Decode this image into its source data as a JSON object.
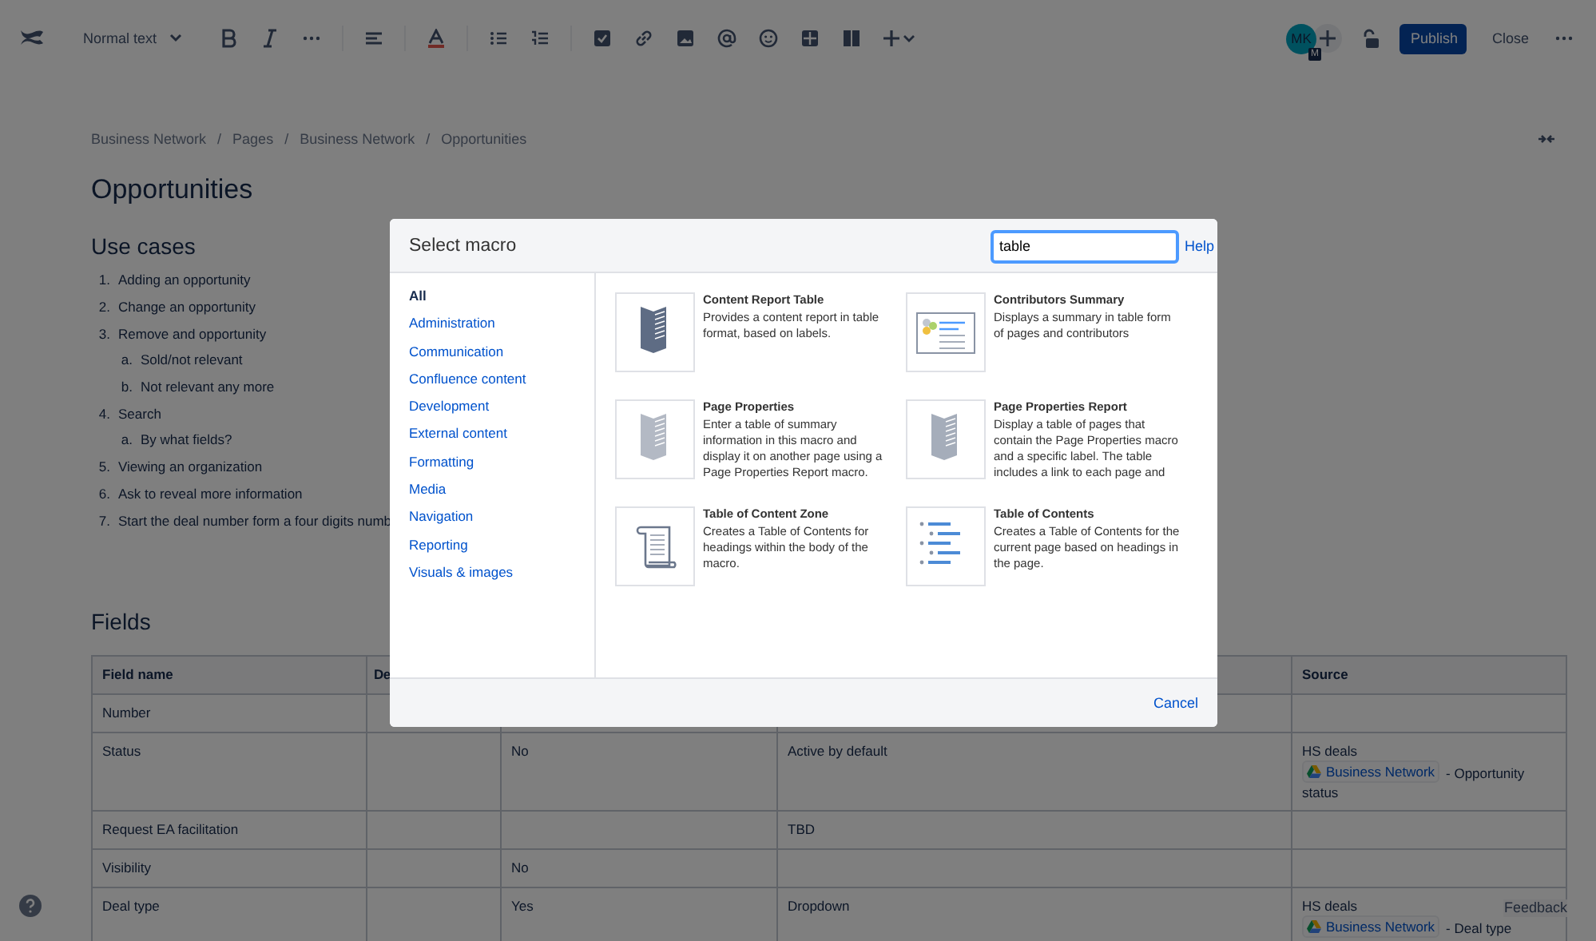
{
  "toolbar": {
    "text_style": "Normal text",
    "avatar": {
      "initials": "MK",
      "badge": "M"
    },
    "publish": "Publish",
    "close": "Close"
  },
  "breadcrumbs": [
    {
      "label": "Business Network"
    },
    {
      "separator": "/",
      "label": "Pages"
    },
    {
      "separator": "/",
      "label": "Business Network"
    },
    {
      "separator": "/",
      "label": "Opportunities"
    }
  ],
  "page_title": "Opportunities",
  "use_cases": {
    "heading": "Use cases",
    "items": [
      {
        "marker": "1.",
        "text": "Adding an opportunity"
      },
      {
        "marker": "2.",
        "text": "Change an opportunity"
      },
      {
        "marker": "3.",
        "text": "Remove and opportunity",
        "children": [
          {
            "marker": "a.",
            "text": "Sold/not relevant"
          },
          {
            "marker": "b.",
            "text": "Not relevant any more"
          }
        ]
      },
      {
        "marker": "4.",
        "text": "Search",
        "children": [
          {
            "marker": "a.",
            "text": "By what fields?"
          }
        ]
      },
      {
        "marker": "5.",
        "text": "Viewing an organization"
      },
      {
        "marker": "6.",
        "text": "Ask to reveal more information"
      },
      {
        "marker": "7.",
        "text": "Start the deal number form a four digits numb"
      }
    ]
  },
  "fields": {
    "heading": "Fields",
    "columns": [
      "Field name",
      "De",
      null,
      null,
      "Source"
    ],
    "rows": [
      [
        "Number",
        null,
        null,
        null,
        null
      ],
      [
        "Status",
        null,
        "No",
        "Active by default",
        {
          "text": "HS deals",
          "link": "Business Network",
          "after": "- Opportunity status"
        }
      ],
      [
        "Request EA facilitation",
        null,
        null,
        "TBD",
        null
      ],
      [
        "Visibility",
        null,
        "No",
        null,
        null
      ],
      [
        "Deal type",
        null,
        "Yes",
        "Dropdown",
        {
          "text": "HS deals",
          "link": "Business Network",
          "after": "- Deal type"
        }
      ]
    ]
  },
  "feedback": "Feedback",
  "dialog": {
    "title": "Select macro",
    "search": {
      "value": "table"
    },
    "help": "Help",
    "categories": [
      {
        "label": "All",
        "selected": true
      },
      {
        "label": "Administration",
        "selected": false
      },
      {
        "label": "Communication",
        "selected": false
      },
      {
        "label": "Confluence content",
        "selected": false
      },
      {
        "label": "Development",
        "selected": false
      },
      {
        "label": "External content",
        "selected": false
      },
      {
        "label": "Formatting",
        "selected": false
      },
      {
        "label": "Media",
        "selected": false
      },
      {
        "label": "Navigation",
        "selected": false
      },
      {
        "label": "Reporting",
        "selected": false
      },
      {
        "label": "Visuals & images",
        "selected": false
      }
    ],
    "macros": [
      {
        "kind": "report",
        "name": "Content Report Table",
        "description": "Provides a content report in table format, based on labels."
      },
      {
        "kind": "summary",
        "name": "Contributors Summary",
        "description": "Displays a summary in table form of pages and contributors"
      },
      {
        "kind": "properties",
        "name": "Page Properties",
        "description": "Enter a table of summary information in this macro and display it on another page using a Page Properties Report macro."
      },
      {
        "kind": "propreport",
        "name": "Page Properties Report",
        "description": "Display a table of pages that contain the Page Properties macro and a specific label. The table includes a link to each page and"
      },
      {
        "kind": "zone",
        "name": "Table of Content Zone",
        "description": "Creates a Table of Contents for headings within the body of the macro."
      },
      {
        "kind": "toc",
        "name": "Table of Contents",
        "description": "Creates a Table of Contents for the current page based on headings in the page."
      }
    ],
    "cancel": "Cancel"
  }
}
